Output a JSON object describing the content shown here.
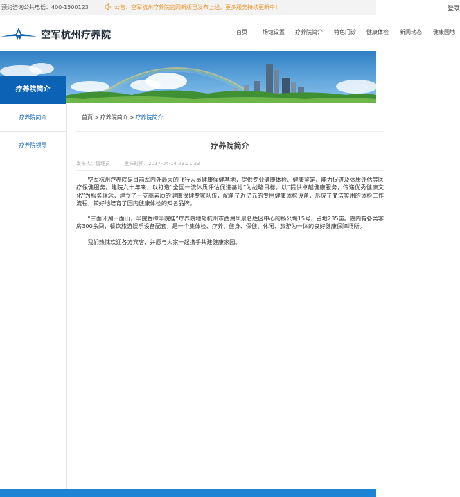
{
  "topbar": {
    "hotline": "预约咨询公共电话：400-1500123",
    "notice": "公告：空军杭州疗养院官网新版已发布上线，更多服务持续更新中！",
    "login": "登录"
  },
  "header": {
    "site_name": "空军杭州疗养院"
  },
  "nav": {
    "items": [
      "首页",
      "场馆设置",
      "疗养院简介",
      "特色门诊",
      "健康体检",
      "新闻动态",
      "健康园地"
    ]
  },
  "sidebar": {
    "title": "疗养院简介",
    "items": [
      "疗养院简介",
      "疗养院领导"
    ]
  },
  "breadcrumb": {
    "home": "首页",
    "parent": "疗养院简介",
    "current": "疗养院简介",
    "separator": ">"
  },
  "article": {
    "title": "疗养院简介",
    "author": "发布人：管理员",
    "published": "发布时间：2017-04-14 23:21:23",
    "paragraphs": [
      "空军杭州疗养院是目前军内外最大的飞行人员健康保健基地，提供专业健康体检、健康鉴定、能力促进及体质评估等医疗保健服务。建院六十年来，以打造“全国一流体质评估促进基地”为战略目标，以“提供卓越健康服务，传递优秀健康文化”为服务理念，建立了一支高素质的健康保健专家队伍，配备了近亿元的专用健康体检设备，形成了简洁实用的体检工作流程，较好地培育了国内健康体检的知名品牌。",
      "“三面环湖一面山，半院香樟半院桂”疗养院地处杭州市西湖风景名胜区中心的杨公堤15号，占地235亩。院内有各类客房300余间，餐饮旅游娱乐设备配套，是一个集体检、疗养、健身、保健、休闲、旅游为一体的良好健康保障场所。",
      "我们热忱欢迎各方宾客，并愿与大家一起携手共建健康家园。"
    ]
  },
  "colors": {
    "primary": "#0c63b6",
    "notice": "#e8932a",
    "footer": "#1e83d3"
  },
  "icons": {
    "notice": "speaker-icon",
    "logo": "wings-logo-icon"
  }
}
